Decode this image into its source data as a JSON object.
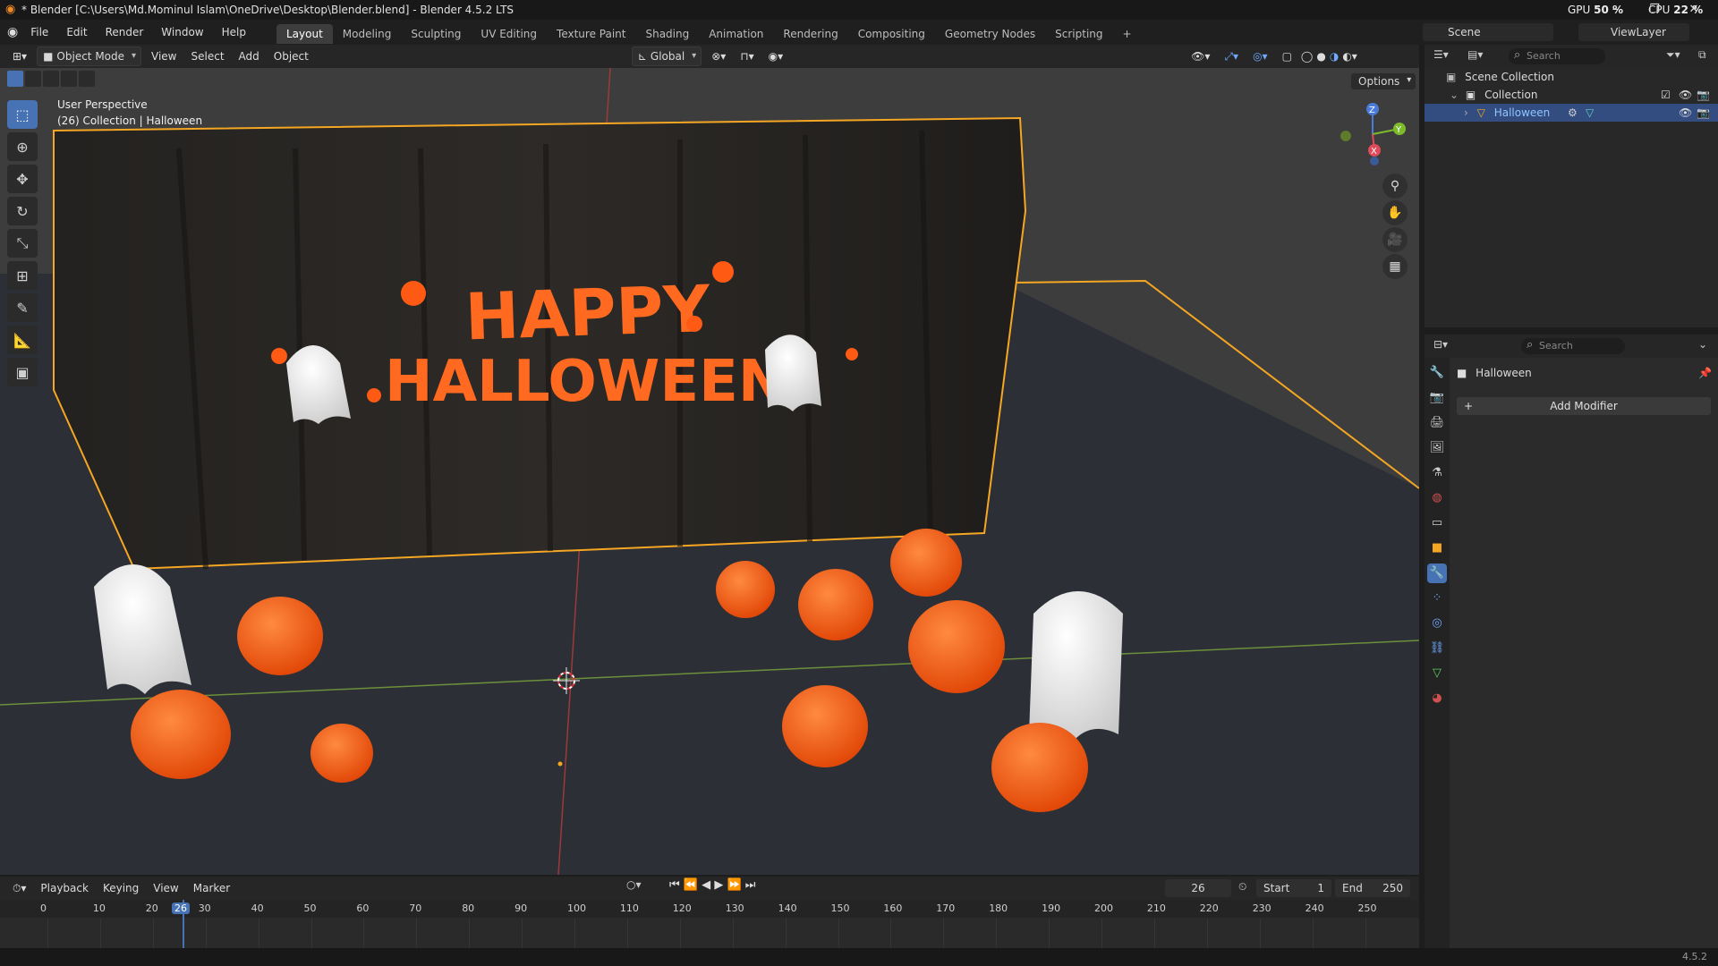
{
  "window": {
    "title": "* Blender [C:\\Users\\Md.Mominul Islam\\OneDrive\\Desktop\\Blender.blend] - Blender 4.5.2 LTS",
    "gpu_label": "GPU",
    "gpu_value": "50 %",
    "cpu_label": "CPU",
    "cpu_value": "22 %"
  },
  "menu": {
    "items": [
      "File",
      "Edit",
      "Render",
      "Window",
      "Help"
    ],
    "workspaces": [
      "Layout",
      "Modeling",
      "Sculpting",
      "UV Editing",
      "Texture Paint",
      "Shading",
      "Animation",
      "Rendering",
      "Compositing",
      "Geometry Nodes",
      "Scripting"
    ],
    "active_workspace": "Layout",
    "scene": "Scene",
    "view_layer": "ViewLayer"
  },
  "viewport_header": {
    "mode": "Object Mode",
    "menus": [
      "View",
      "Select",
      "Add",
      "Object"
    ],
    "transform_orientation": "Global",
    "options_label": "Options"
  },
  "viewport": {
    "perspective_label": "User Perspective",
    "collection_label": "(26) Collection | Halloween",
    "banner_text_1": "HAPPY",
    "banner_text_2": "HALLOWEEN",
    "gizmo_z": "Z",
    "gizmo_y": "Y",
    "gizmo_x": "X"
  },
  "outliner": {
    "search_placeholder": "Search",
    "scene_collection": "Scene Collection",
    "collection": "Collection",
    "object": "Halloween"
  },
  "properties": {
    "search_placeholder": "Search",
    "object_name": "Halloween",
    "add_modifier": "Add Modifier"
  },
  "timeline": {
    "menus": [
      "Playback",
      "Keying",
      "View",
      "Marker"
    ],
    "current_frame": "26",
    "start_label": "Start",
    "start_value": "1",
    "end_label": "End",
    "end_value": "250",
    "ticks": [
      "0",
      "10",
      "20",
      "30",
      "40",
      "50",
      "60",
      "70",
      "80",
      "90",
      "100",
      "110",
      "120",
      "130",
      "140",
      "150",
      "160",
      "170",
      "180",
      "190",
      "200",
      "210",
      "220",
      "230",
      "240",
      "250"
    ]
  },
  "status": {
    "version": "4.5.2"
  },
  "colors": {
    "accent": "#4772b3",
    "pumpkin": "#ff5a14",
    "selection_outline": "#f5a623"
  }
}
